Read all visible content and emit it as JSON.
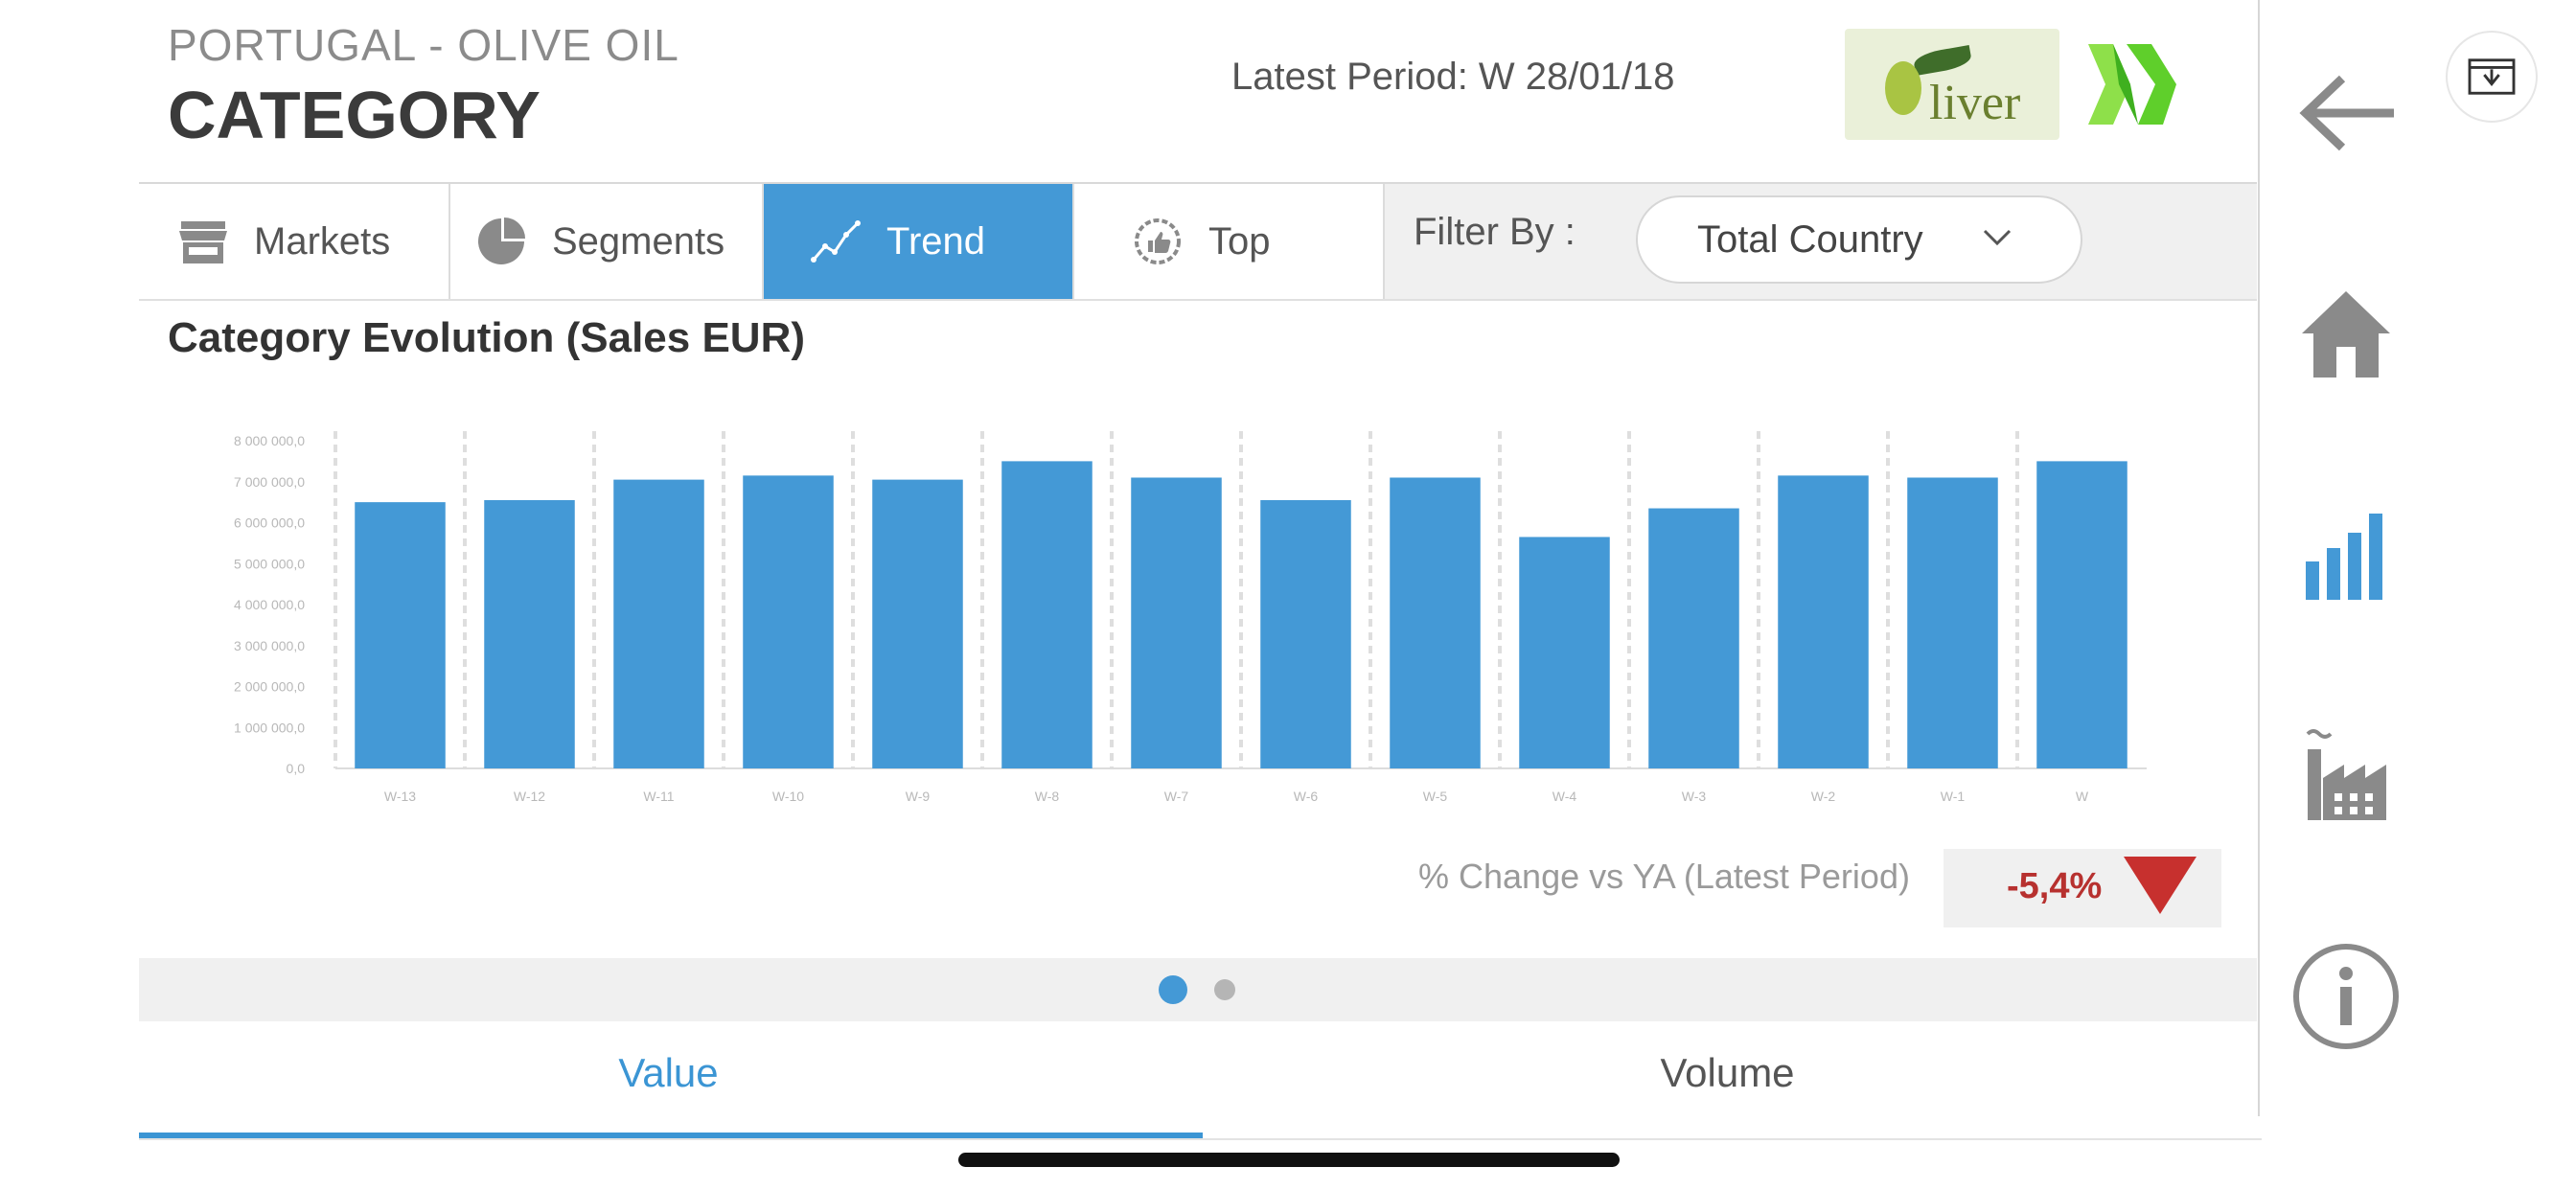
{
  "header": {
    "supertitle": "PORTUGAL - OLIVE OIL",
    "title": "CATEGORY",
    "latest_period": "Latest Period: W 28/01/18",
    "brand_logo_text": "liver"
  },
  "tabs": [
    {
      "label": "Markets",
      "icon": "store-icon"
    },
    {
      "label": "Segments",
      "icon": "pie-chart-icon"
    },
    {
      "label": "Trend",
      "icon": "trend-line-icon",
      "active": true
    },
    {
      "label": "Top",
      "icon": "thumbs-up-badge-icon"
    }
  ],
  "filter": {
    "label": "Filter By :",
    "selected": "Total Country"
  },
  "section_title": "Category Evolution (Sales EUR)",
  "chart_data": {
    "type": "bar",
    "categories": [
      "W-13",
      "W-12",
      "W-11",
      "W-10",
      "W-9",
      "W-8",
      "W-7",
      "W-6",
      "W-5",
      "W-4",
      "W-3",
      "W-2",
      "W-1",
      "W"
    ],
    "values": [
      6500000,
      6550000,
      7050000,
      7150000,
      7050000,
      7500000,
      7100000,
      6550000,
      7100000,
      5650000,
      6350000,
      7150000,
      7100000,
      7500000
    ],
    "yticks": [
      "0,0",
      "1 000 000,0",
      "2 000 000,0",
      "3 000 000,0",
      "4 000 000,0",
      "5 000 000,0",
      "6 000 000,0",
      "7 000 000,0",
      "8 000 000,0"
    ],
    "ylim": [
      0,
      8000000
    ],
    "bar_color": "#4499d6",
    "grid": "dashed vertical separators"
  },
  "change": {
    "label": "% Change vs YA (Latest Period)",
    "value": "-5,4%",
    "color": "#b7312f"
  },
  "carousel": {
    "pages": 2,
    "active": 1
  },
  "bottom_tabs": [
    {
      "label": "Value",
      "active": true
    },
    {
      "label": "Volume"
    }
  ],
  "sidebar": {
    "icons": [
      "download-icon",
      "back-arrow-icon",
      "home-icon",
      "bar-chart-icon",
      "factory-icon",
      "info-icon"
    ]
  },
  "colors": {
    "accent": "#4499d6",
    "negative": "#b7312f"
  }
}
